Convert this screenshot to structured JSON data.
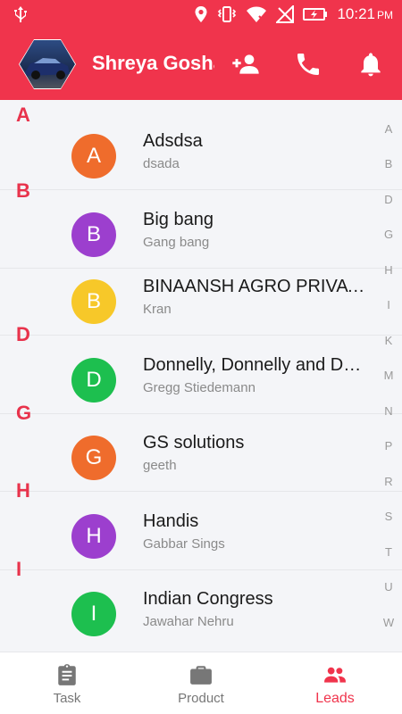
{
  "status_bar": {
    "time": "10:21",
    "ampm": "PM"
  },
  "header": {
    "user_name": "Shreya Goshal"
  },
  "sections": [
    {
      "letter": "A",
      "leads": [
        {
          "initial": "A",
          "name": "Adsdsa",
          "contact": "dsada",
          "color": "#ef6c2c"
        }
      ]
    },
    {
      "letter": "B",
      "leads": [
        {
          "initial": "B",
          "name": "Big bang",
          "contact": "Gang bang",
          "color": "#9c3fce"
        },
        {
          "initial": "B",
          "name": "BINAANSH AGRO PRIVATE LIMITED",
          "contact": "Kran",
          "color": "#f7c829"
        }
      ]
    },
    {
      "letter": "D",
      "leads": [
        {
          "initial": "D",
          "name": "Donnelly, Donnelly and Donnelly",
          "contact": "Gregg Stiedemann",
          "color": "#1dbf4f"
        }
      ]
    },
    {
      "letter": "G",
      "leads": [
        {
          "initial": "G",
          "name": "GS solutions",
          "contact": "geeth",
          "color": "#ef6c2c"
        }
      ]
    },
    {
      "letter": "H",
      "leads": [
        {
          "initial": "H",
          "name": "Handis",
          "contact": "Gabbar Sings",
          "color": "#9c3fce"
        }
      ]
    },
    {
      "letter": "I",
      "leads": [
        {
          "initial": "I",
          "name": "Indian Congress",
          "contact": "Jawahar Nehru",
          "color": "#1dbf4f"
        }
      ]
    }
  ],
  "alphabet_index": [
    "A",
    "B",
    "D",
    "G",
    "H",
    "I",
    "K",
    "M",
    "N",
    "P",
    "R",
    "S",
    "T",
    "U",
    "W"
  ],
  "bottom_nav": [
    {
      "label": "Task",
      "icon": "clipboard-icon",
      "active": false
    },
    {
      "label": "Product",
      "icon": "briefcase-icon",
      "active": false
    },
    {
      "label": "Leads",
      "icon": "people-icon",
      "active": true
    }
  ],
  "colors": {
    "primary": "#f0344c",
    "background": "#f4f5f8"
  }
}
